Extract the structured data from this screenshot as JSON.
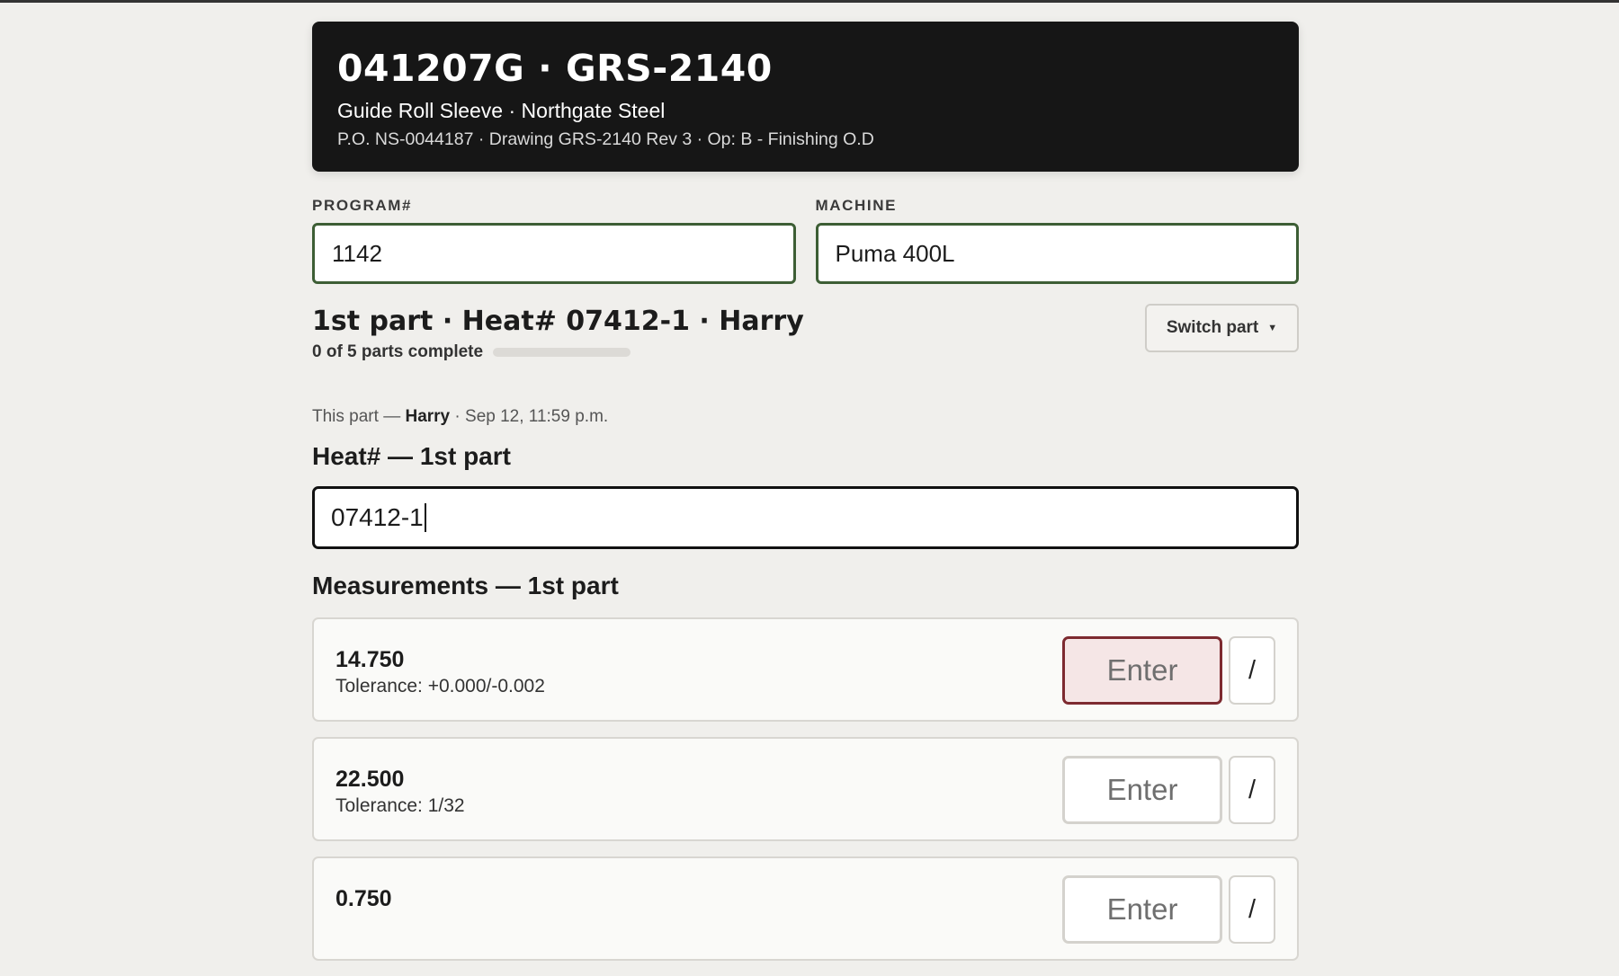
{
  "header": {
    "title": "041207G · GRS-2140",
    "subtitle": "Guide Roll Sleeve · Northgate Steel",
    "meta": "P.O. NS-0044187 · Drawing GRS-2140 Rev 3 · Op: B - Finishing O.D"
  },
  "program": {
    "label": "PROGRAM#",
    "value": "1142"
  },
  "machine": {
    "label": "MACHINE",
    "value": "Puma 400L"
  },
  "part": {
    "title": "1st part · Heat# 07412-1 · Harry",
    "progress_text": "0 of 5 parts complete",
    "progress_fraction": 0,
    "switch_label": "Switch part",
    "switch_icon": "caret-down-icon",
    "switch_caret": "▼"
  },
  "this_part": {
    "prefix": "This part —",
    "operator": "Harry",
    "timestamp": "· Sep 12, 11:59 p.m."
  },
  "heat": {
    "heading": "Heat# — 1st part",
    "value": "07412-1"
  },
  "measurements": {
    "heading": "Measurements — 1st part",
    "items": [
      {
        "value": "14.750",
        "tolerance": "Tolerance: +0.000/-0.002",
        "enter": "Enter",
        "alt": "/"
      },
      {
        "value": "22.500",
        "tolerance": "Tolerance: 1/32",
        "enter": "Enter",
        "alt": "/"
      },
      {
        "value": "0.750",
        "tolerance": "",
        "enter": "Enter",
        "alt": "/"
      }
    ]
  },
  "colors": {
    "accent_green": "#3d5e35",
    "active_red": "#7d2a30",
    "header_bg": "#161616"
  }
}
